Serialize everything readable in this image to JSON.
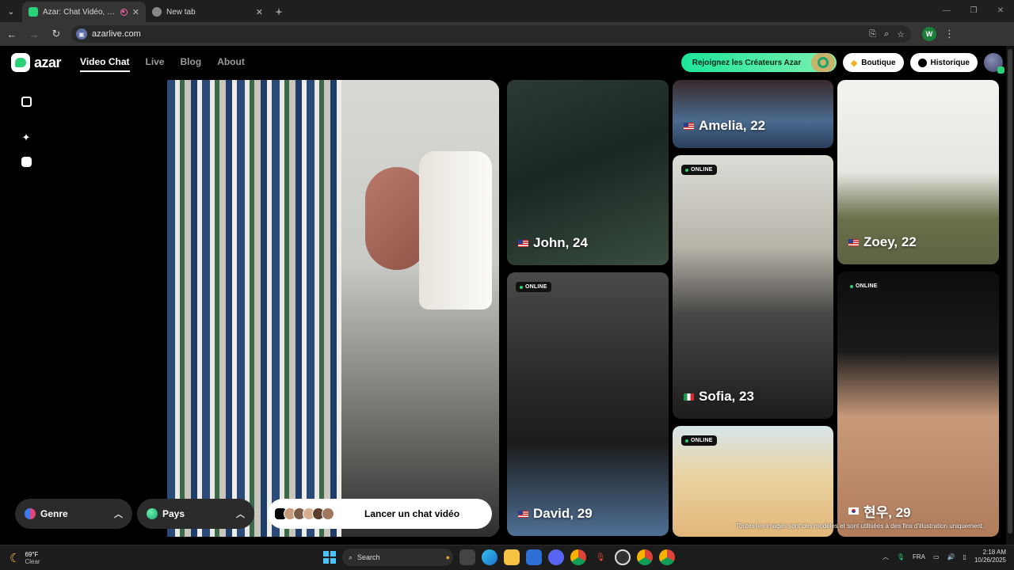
{
  "browser": {
    "tabs": [
      {
        "title": "Azar: Chat Vidéo, Rencontre",
        "active": true,
        "favicon_color": "#29d178"
      },
      {
        "title": "New tab",
        "active": false,
        "favicon_color": "#888888"
      }
    ],
    "url": "azarlive.com",
    "profile_initial": "W"
  },
  "header": {
    "brand": "azar",
    "nav": [
      "Video Chat",
      "Live",
      "Blog",
      "About"
    ],
    "creators_label": "Rejoignez les Créateurs Azar",
    "boutique_label": "Boutique",
    "historique_label": "Historique"
  },
  "controls": {
    "genre_label": "Genre",
    "pays_label": "Pays",
    "launch_label": "Lancer un chat vidéo"
  },
  "profiles": {
    "john": {
      "name": "John, 24",
      "country": "us",
      "online": false
    },
    "amelia": {
      "name": "Amelia, 22",
      "country": "us",
      "online": false
    },
    "zoey": {
      "name": "Zoey, 22",
      "country": "us",
      "online": false
    },
    "sofia": {
      "name": "Sofia, 23",
      "country": "it",
      "online": true
    },
    "david": {
      "name": "David, 29",
      "country": "us",
      "online": true
    },
    "hyunwoo": {
      "name": "현우, 29",
      "country": "kr",
      "online": true
    },
    "blonde": {
      "online": true
    }
  },
  "online_label": "ONLINE",
  "disclaimer": "Toutes les images sont des modèles et sont utilisées à des fins d'illustration uniquement.",
  "taskbar": {
    "temperature": "69°F",
    "condition": "Clear",
    "search_placeholder": "Search",
    "language": "FRA",
    "time": "2:18 AM",
    "date": "10/26/2025"
  },
  "colors": {
    "brand_green": "#29d178",
    "creators_gradient_start": "#1de59a",
    "online_dot": "#29d178"
  }
}
